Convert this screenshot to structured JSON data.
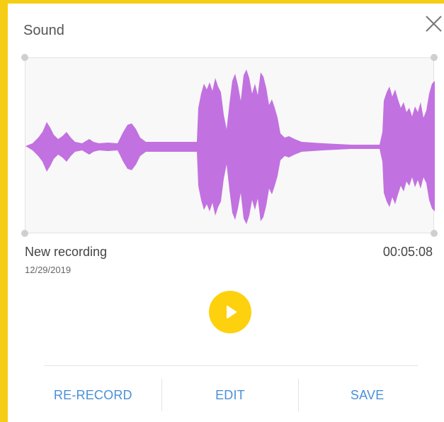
{
  "dialog": {
    "title": "Sound",
    "close_icon": "close-icon"
  },
  "recording": {
    "name": "New recording",
    "date": "12/29/2019",
    "duration": "00:05:08"
  },
  "waveform": {
    "color": "#c271e0"
  },
  "playback": {
    "play_icon": "play-icon",
    "button_color": "#fdd10e"
  },
  "actions": {
    "rerecord_label": "RE-RECORD",
    "edit_label": "EDIT",
    "save_label": "SAVE"
  },
  "colors": {
    "frame": "#f5cd15",
    "action_text": "#4a90d9"
  }
}
